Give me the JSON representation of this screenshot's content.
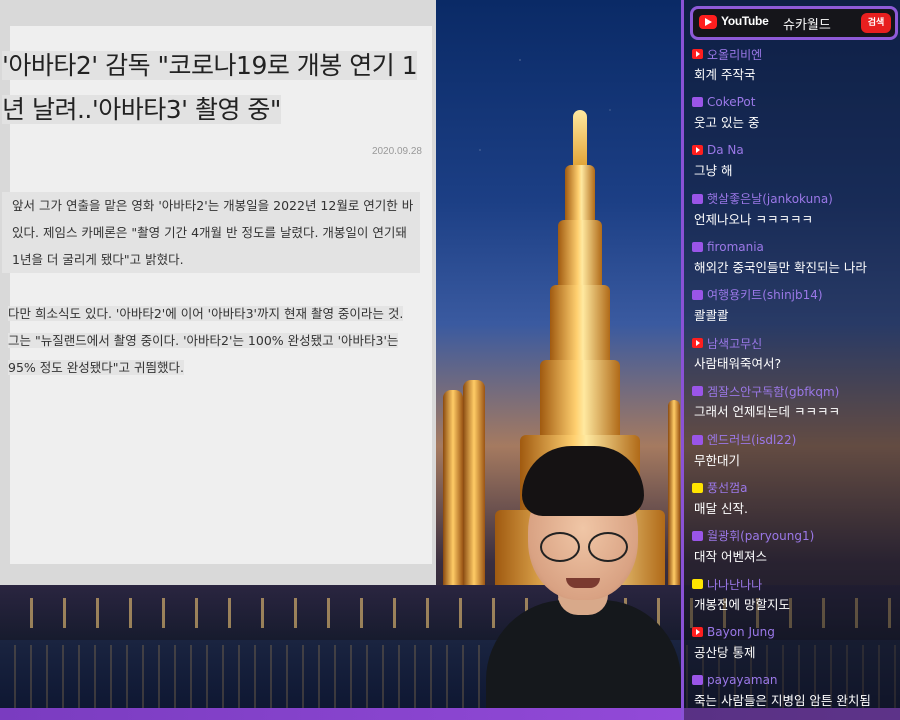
{
  "article": {
    "headline": "'아바타2' 감독 \"코로나19로 개봉 연기 1년 날려..'아바타3' 촬영 중\"",
    "date": "2020.09.28",
    "paragraph1": "앞서 그가 연출을 맡은 영화 '아바타2'는 개봉일을 2022년 12월로 연기한 바 있다. 제임스 카메론은 \"촬영 기간 4개월 반 정도를 날렸다. 개봉일이 연기돼 1년을 더 굴리게 됐다\"고 밝혔다.",
    "paragraph2": "다만 희소식도 있다. '아바타2'에 이어 '아바타3'까지 현재 촬영 중이라는 것. 그는 \"뉴질랜드에서 촬영 중이다. '아바타2'는 100% 완성됐고 '아바타3'는 95% 정도 완성됐다\"고 귀띔했다."
  },
  "chat_header": {
    "platform": "YouTube",
    "channel": "슈카월드",
    "search_label": "검색"
  },
  "messages": [
    {
      "badge": "youtube",
      "user": "오올리비엔",
      "text": "회계 주작국"
    },
    {
      "badge": "twitch",
      "user": "CokePot",
      "text": "웃고 있는 중"
    },
    {
      "badge": "youtube",
      "user": "Da Na",
      "text": "그냥 해"
    },
    {
      "badge": "twitch",
      "user": "햇살좋은날(jankokuna)",
      "text": "언제나오나 ㅋㅋㅋㅋㅋ"
    },
    {
      "badge": "twitch",
      "user": "firomania",
      "text": "해외간 중국인들만 확진되는 나라"
    },
    {
      "badge": "twitch",
      "user": "여행용키트(shinjb14)",
      "text": "콸콸콸"
    },
    {
      "badge": "youtube",
      "user": "남색고무신",
      "text": "사람태워죽여서?"
    },
    {
      "badge": "twitch",
      "user": "겜잘스안구독함(gbfkqm)",
      "text": "그래서 언제되는데 ㅋㅋㅋㅋ"
    },
    {
      "badge": "twitch",
      "user": "엔드러브(isdl22)",
      "text": "무한대기"
    },
    {
      "badge": "kakao",
      "user": "풍선껌a",
      "text": "매달 신작."
    },
    {
      "badge": "twitch",
      "user": "월광휘(paryoung1)",
      "text": "대작 어벤져스"
    },
    {
      "badge": "kakao",
      "user": "나나난나나",
      "text": "개봉전에 망할지도"
    },
    {
      "badge": "youtube",
      "user": "Bayon Jung",
      "text": "공산당 통제"
    },
    {
      "badge": "twitch",
      "user": "payayaman",
      "text": "죽는 사람들은 지병임 암튼 완치됨"
    }
  ],
  "colors": {
    "accent": "#8e5ad8",
    "youtube_red": "#ff1e1e",
    "username": "#9b78e8"
  }
}
